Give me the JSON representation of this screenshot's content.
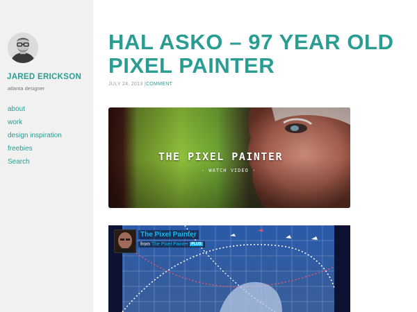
{
  "sidebar": {
    "site_title": "JARED ERICKSON",
    "tagline": "atlanta designer",
    "nav": [
      {
        "label": "about"
      },
      {
        "label": "work"
      },
      {
        "label": "design inspiration"
      },
      {
        "label": "freebies"
      },
      {
        "label": "Search"
      }
    ]
  },
  "post": {
    "title": "HAL ASKO – 97 YEAR OLD PIXEL PAINTER",
    "date": "JULY 24, 2013",
    "separator": "|",
    "comment_link": "COMMENT"
  },
  "video1": {
    "title": "THE PIXEL PAINTER",
    "subtitle": "- WATCH VIDEO -"
  },
  "video2": {
    "title": "The Pixel Painter",
    "from": "from",
    "author": "The Pixel Painter",
    "badge": "PLUS"
  },
  "colors": {
    "accent": "#2a9d93",
    "sidebar_bg": "#f1f1f1",
    "vimeo_blue": "#16b6f2"
  }
}
